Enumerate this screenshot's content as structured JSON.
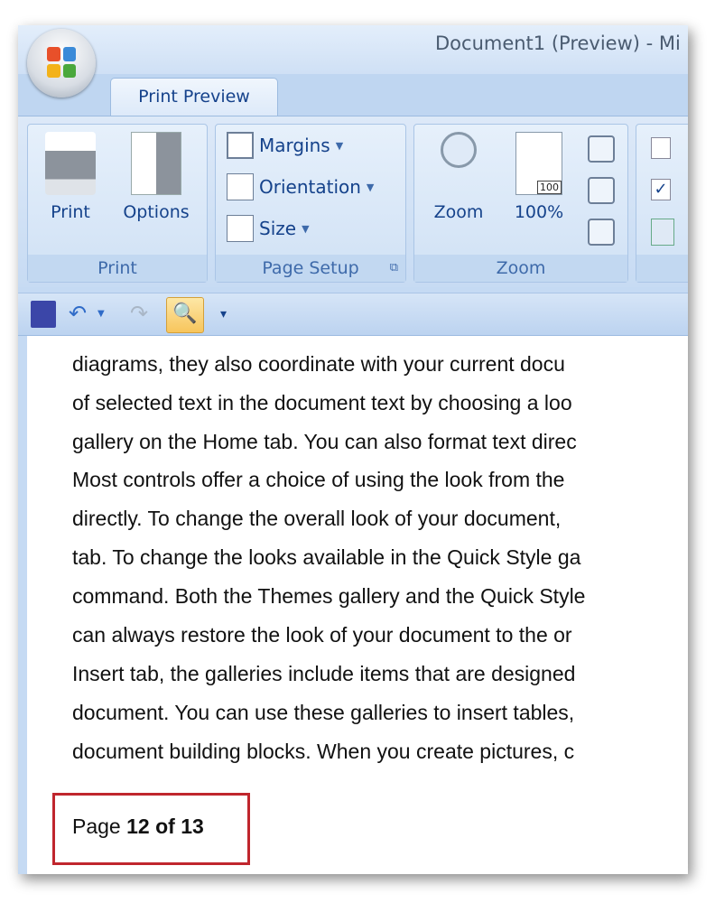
{
  "window": {
    "title": "Document1 (Preview) - Mi"
  },
  "ribbon": {
    "tab": "Print Preview",
    "groups": {
      "print": {
        "label": "Print",
        "print": "Print",
        "options": "Options"
      },
      "page_setup": {
        "label": "Page Setup",
        "margins": "Margins",
        "orientation": "Orientation",
        "size": "Size"
      },
      "zoom": {
        "label": "Zoom",
        "zoom": "Zoom",
        "hundred": "100%",
        "page_badge": "100"
      }
    }
  },
  "quick_access": [
    "save-icon",
    "undo-icon",
    "redo-icon",
    "print-preview-icon",
    "customize-icon"
  ],
  "document": {
    "lines": [
      "diagrams, they also coordinate with your current docu",
      "of selected text in the document text by choosing a  loo",
      "gallery on the Home tab. You can also format text direc",
      "Most controls offer a choice of using the look from the",
      "directly. To change the overall look of your document,",
      "tab. To change the looks available in the Quick Style ga",
      "command. Both the Themes gallery and the Quick Style",
      "can always restore the look of your document to the or",
      "Insert tab, the galleries include items that are designed",
      "document. You can use these galleries to insert tables,",
      "document building blocks. When you create pictures, c"
    ]
  },
  "status": {
    "page_prefix": "Page ",
    "page_current": "12",
    "page_of": " of ",
    "page_total": "13"
  },
  "colors": {
    "highlight_box": "#c0262d",
    "ribbon_text": "#15428b"
  }
}
